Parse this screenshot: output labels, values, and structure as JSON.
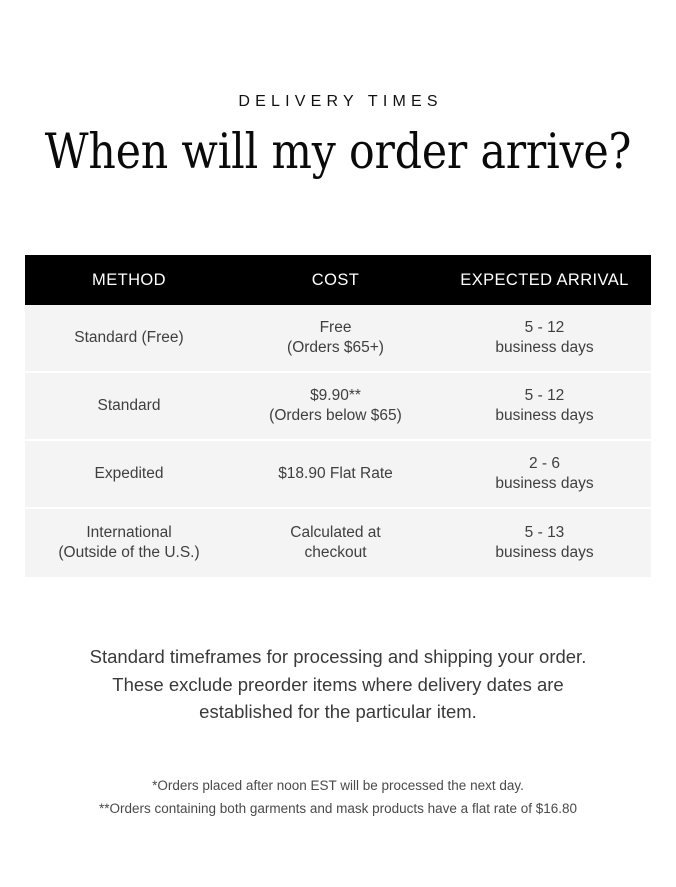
{
  "header": {
    "eyebrow": "DELIVERY TIMES",
    "headline": "When will my order arrive?"
  },
  "table": {
    "columns": [
      "METHOD",
      "COST",
      "EXPECTED ARRIVAL"
    ],
    "rows": [
      {
        "method_line1": "Standard (Free)",
        "method_line2": "",
        "cost_line1": "Free",
        "cost_line2": "(Orders $65+)",
        "arrival_line1": "5 - 12",
        "arrival_line2": "business days"
      },
      {
        "method_line1": "Standard",
        "method_line2": "",
        "cost_line1": "$9.90**",
        "cost_line2": "(Orders below $65)",
        "arrival_line1": "5 - 12",
        "arrival_line2": "business days"
      },
      {
        "method_line1": "Expedited",
        "method_line2": "",
        "cost_line1": "$18.90 Flat Rate",
        "cost_line2": "",
        "arrival_line1": "2 - 6",
        "arrival_line2": "business days"
      },
      {
        "method_line1": "International",
        "method_line2": "(Outside of the U.S.)",
        "cost_line1": "Calculated at",
        "cost_line2": "checkout",
        "arrival_line1": "5 - 13",
        "arrival_line2": "business days"
      }
    ]
  },
  "body": {
    "line1": "Standard timeframes for processing and shipping your order.",
    "line2": "These exclude preorder items where delivery dates are",
    "line3": "established for the particular item."
  },
  "footnotes": {
    "line1": "*Orders placed after noon EST will be processed the next day.",
    "line2": "**Orders containing both garments and mask products have a flat rate of $16.80"
  },
  "colors": {
    "page_background": "#ffffff",
    "header_row_background": "#000000",
    "header_row_text": "#ffffff",
    "data_row_background": "#f4f4f4",
    "data_row_text": "#3f3f3f",
    "headline_text": "#0a0a0a",
    "body_text": "#3a3a3a",
    "footnote_text": "#4a4a4a"
  }
}
